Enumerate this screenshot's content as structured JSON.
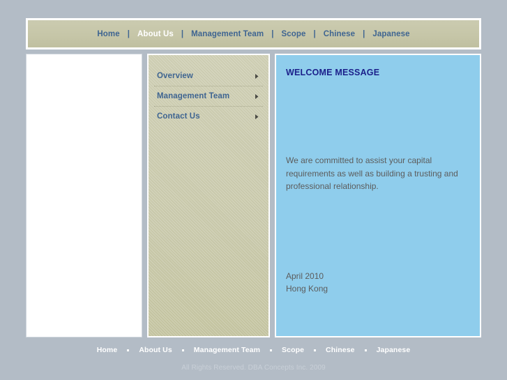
{
  "colors": {
    "page_background": "#b3bcc6",
    "header_khaki": "#c8c8ab",
    "sidebar_khaki": "#c9c9ac",
    "panel_blue": "#8fcdec",
    "link_blue": "#3f6591",
    "heading_navy": "#1b1f8a",
    "body_gray": "#5c5c5c",
    "footer_text": "#ffffff",
    "copyright_text": "#c9d0d8"
  },
  "topnav": {
    "separator": "|",
    "items": [
      {
        "label": "Home",
        "active": false
      },
      {
        "label": "About Us",
        "active": true
      },
      {
        "label": "Management Team",
        "active": false
      },
      {
        "label": "Scope",
        "active": false
      },
      {
        "label": "Chinese",
        "active": false
      },
      {
        "label": "Japanese",
        "active": false
      }
    ]
  },
  "sidebar": {
    "items": [
      {
        "label": "Overview",
        "icon": "arrow-right-icon"
      },
      {
        "label": "Management Team",
        "icon": "arrow-right-icon"
      },
      {
        "label": "Contact Us",
        "icon": "arrow-right-icon"
      }
    ]
  },
  "welcome": {
    "title": "WELCOME MESSAGE",
    "paragraph": "We are committed to assist your capital requirements as well as building a trusting and professional relationship.",
    "date": "April 2010",
    "location": "Hong Kong"
  },
  "footer": {
    "items": [
      {
        "label": "Home"
      },
      {
        "label": "About Us"
      },
      {
        "label": "Management Team"
      },
      {
        "label": "Scope"
      },
      {
        "label": "Chinese"
      },
      {
        "label": "Japanese"
      }
    ],
    "copyright": "All Rights Reserved. DBA Concepts Inc. 2009"
  }
}
